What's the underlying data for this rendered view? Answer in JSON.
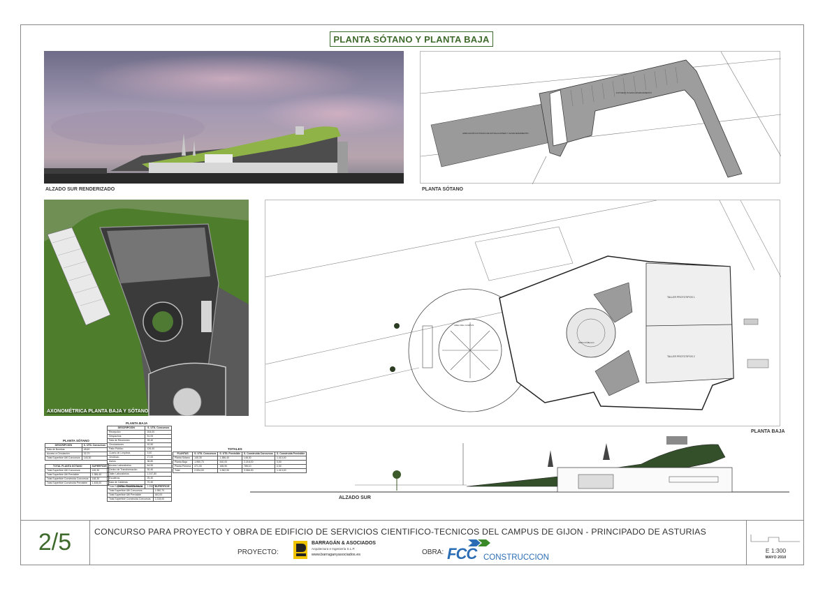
{
  "sheet_title": "PLANTA SÓTANO Y PLANTA BAJA",
  "captions": {
    "render": "ALZADO SUR RENDERIZADO",
    "basement": "PLANTA SÓTANO",
    "axo": "AXONOMÉTRICA PLANTA BAJA Y SÓTANO",
    "ground": "PLANTA BAJA",
    "elevation": "ALZADO SUR"
  },
  "tables": {
    "sotano": {
      "title": "PLANTA SÓTANO",
      "headers": [
        "DESCRIPCIÓN",
        "S. ÚTIL Concursos"
      ],
      "rows": [
        [
          "Sala de Bombas",
          "48,60"
        ],
        [
          "Acceso a Circulación",
          "32,70"
        ],
        [
          "Total Superficie Útil Concursos",
          "145,30"
        ]
      ]
    },
    "sotano_totals": {
      "headers": [
        "TOTAL PLANTA SÓTANO",
        "SUPERFICIE"
      ],
      "rows": [
        [
          "Total Superficie Útil Concursos",
          "145,30"
        ],
        [
          "Total Superficie Útil Previsible",
          "1.386,40"
        ],
        [
          "Total Superficie Construida Concursos",
          "148,30"
        ],
        [
          "Total Superficie Construida Previsible",
          "1.408,00"
        ]
      ]
    },
    "baja": {
      "title": "PLANTA BAJA",
      "headers": [
        "DESCRIPCIÓN",
        "S. ÚTIL Concursos"
      ],
      "rows": [
        [
          "Recepción",
          "204,00"
        ],
        [
          "Despachos",
          "51,00"
        ],
        [
          "Sala de Reuniones",
          "28,40"
        ],
        [
          "Circulaciones",
          "92,50"
        ],
        [
          "Patio Público",
          "126,40"
        ],
        [
          "Cuarto de Limpieza",
          "9,40"
        ],
        [
          "Vestíbulo",
          "27,00"
        ],
        [
          "Aseos",
          "38,80"
        ],
        [
          "Acceso Laboratorios",
          "64,50"
        ],
        [
          "Centro de Transformación",
          "30,40"
        ],
        [
          "Taller Laboratorios",
          "1.047,80"
        ],
        [
          "Escaleras",
          "25,40"
        ],
        [
          "Sala de Calderas",
          "70,40"
        ],
        [
          "Total Superficie Útil Concursos",
          "1.950,70"
        ]
      ]
    },
    "baja_totals": {
      "headers": [
        "TOTAL PLANTA BAJA",
        "SUPERFICIE"
      ],
      "rows": [
        [
          "Total Superficie Útil Concursos",
          "1.950,70"
        ],
        [
          "Total Superficie Útil Previsible",
          "440,00"
        ],
        [
          "Total Superficie Construida Concursos",
          "2.218,00"
        ]
      ]
    },
    "totales": {
      "title": "TOTALES",
      "headers": [
        "PLANTAS",
        "S. ÚTIL Concursos",
        "S. ÚTIL Previsible",
        "S. Construida Concursos",
        "S. Construida Previsible"
      ],
      "rows": [
        [
          "Planta Sótano",
          "145,30",
          "1.386,40",
          "148,30",
          "1.413,00"
        ],
        [
          "Planta Baja",
          "1.950,70",
          "440,00",
          "2.218,00",
          "0,00"
        ],
        [
          "Planta Primera",
          "471,00",
          "155,90",
          "785,10",
          "0,00"
        ],
        [
          "Total",
          "2.534,00",
          "1.962,90",
          "3.066,90",
          "1.413,00"
        ]
      ]
    }
  },
  "plan_labels": {
    "basement_area": "AMPLIACIÓN FUTURAS DE INSTALACIONES Y ALMACENAMIENTO",
    "basement_parking": "FUTURAS PLAZAS APARCAMIENTO",
    "ground_lab1": "TALLER PROTOTIPOS 1",
    "ground_lab2": "TALLER PROTOTIPOS 2",
    "ground_patio": "PATIO PÚBLICO",
    "ground_plaza": "AREA DEL CAMPUS"
  },
  "footer": {
    "sheet_number": "2/5",
    "contest_title": "CONCURSO PARA PROYECTO Y OBRA DE EDIFICIO DE SERVICIOS CIENTIFICO-TECNICOS DEL CAMPUS DE GIJON - PRINCIPADO DE  ASTURIAS",
    "proyecto_label": "PROYECTO:",
    "architect_name": "BARRAGÁN & ASOCIADOS",
    "architect_sub": "Arquitectura e Ingeniería S.L.P.",
    "architect_url": "www.barraganyasociados.es",
    "obra_label": "OBRA:",
    "builder_logo": "FCC",
    "builder_name": "CONSTRUCCION",
    "scale": "E 1:300",
    "date": "MAYO 2010"
  },
  "colors": {
    "accent": "#3d6a2a",
    "roof_green": "#8fb346",
    "grass": "#4e7d2c"
  }
}
